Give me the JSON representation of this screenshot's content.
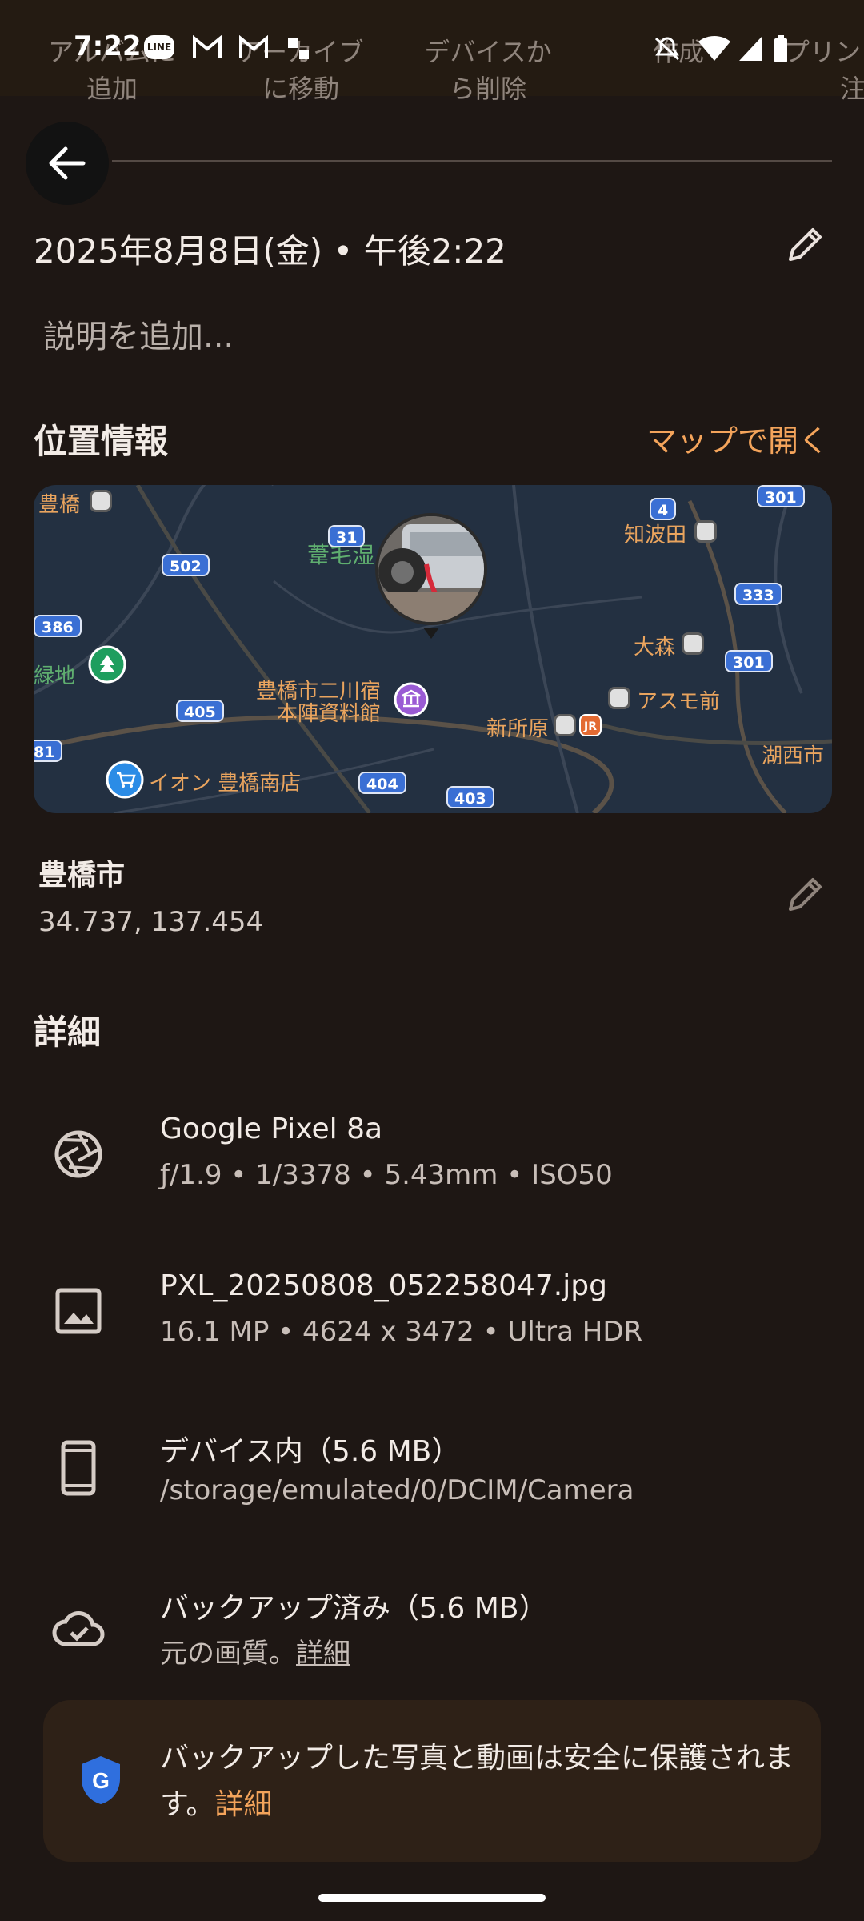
{
  "status_bar": {
    "time": "7:22",
    "line_badge": "LINE",
    "icons": [
      "line-icon",
      "gmail-icon",
      "gmail-icon",
      "drive-icon",
      "mute-icon",
      "wifi-icon",
      "signal-icon",
      "battery-icon"
    ]
  },
  "action_row": {
    "items": [
      {
        "line1": "アルバムに",
        "line2": "追加"
      },
      {
        "line1": "アーカイブ",
        "line2": "に移動"
      },
      {
        "line1": "デバイスか",
        "line2": "ら削除"
      },
      {
        "line1": "作成",
        "line2": ""
      },
      {
        "line1": "プリン",
        "line2": "注"
      }
    ]
  },
  "header": {
    "date": "2025年8月8日(金) • 午後2:22",
    "description_placeholder": "説明を追加..."
  },
  "location": {
    "title": "位置情報",
    "open_map_label": "マップで開く",
    "map_labels": {
      "toyohashi": "豊橋",
      "nirakawa": "葦毛湿",
      "chibata": "知波田",
      "omori": "大森",
      "asumo": "アスモ前",
      "shinjohara": "新所原",
      "kosai": "湖西市",
      "museum_l1": "豊橋市二川宿",
      "museum_l2": "本陣資料館",
      "ryokuchi": "緑地",
      "aeon": "イオン 豊橋南店",
      "jr": "JR",
      "route_31": "31",
      "route_502": "502",
      "route_386": "386",
      "route_405": "405",
      "route_404": "404",
      "route_403": "403",
      "route_4": "4",
      "route_333": "333",
      "route_301a": "301",
      "route_301b": "301",
      "route_81": "81"
    },
    "place": "豊橋市",
    "coordinates": "34.737, 137.454"
  },
  "details": {
    "title": "詳細",
    "camera": {
      "title": "Google Pixel 8a",
      "sub": "ƒ/1.9 • 1/3378 • 5.43mm • ISO50"
    },
    "file": {
      "title": "PXL_20250808_052258047.jpg",
      "sub": "16.1 MP • 4624 x 3472 • Ultra HDR"
    },
    "device": {
      "title": "デバイス内（5.6 MB）",
      "sub": "/storage/emulated/0/DCIM/Camera"
    },
    "backup": {
      "title": "バックアップ済み（5.6 MB）",
      "sub_prefix": "元の画質。",
      "sub_link": "詳細"
    }
  },
  "backup_card": {
    "text": "バックアップした写真と動画は安全に保護されます。",
    "link": "詳細"
  },
  "colors": {
    "background": "#1e1714",
    "accent": "#f4a45b",
    "card": "#2e2117"
  }
}
